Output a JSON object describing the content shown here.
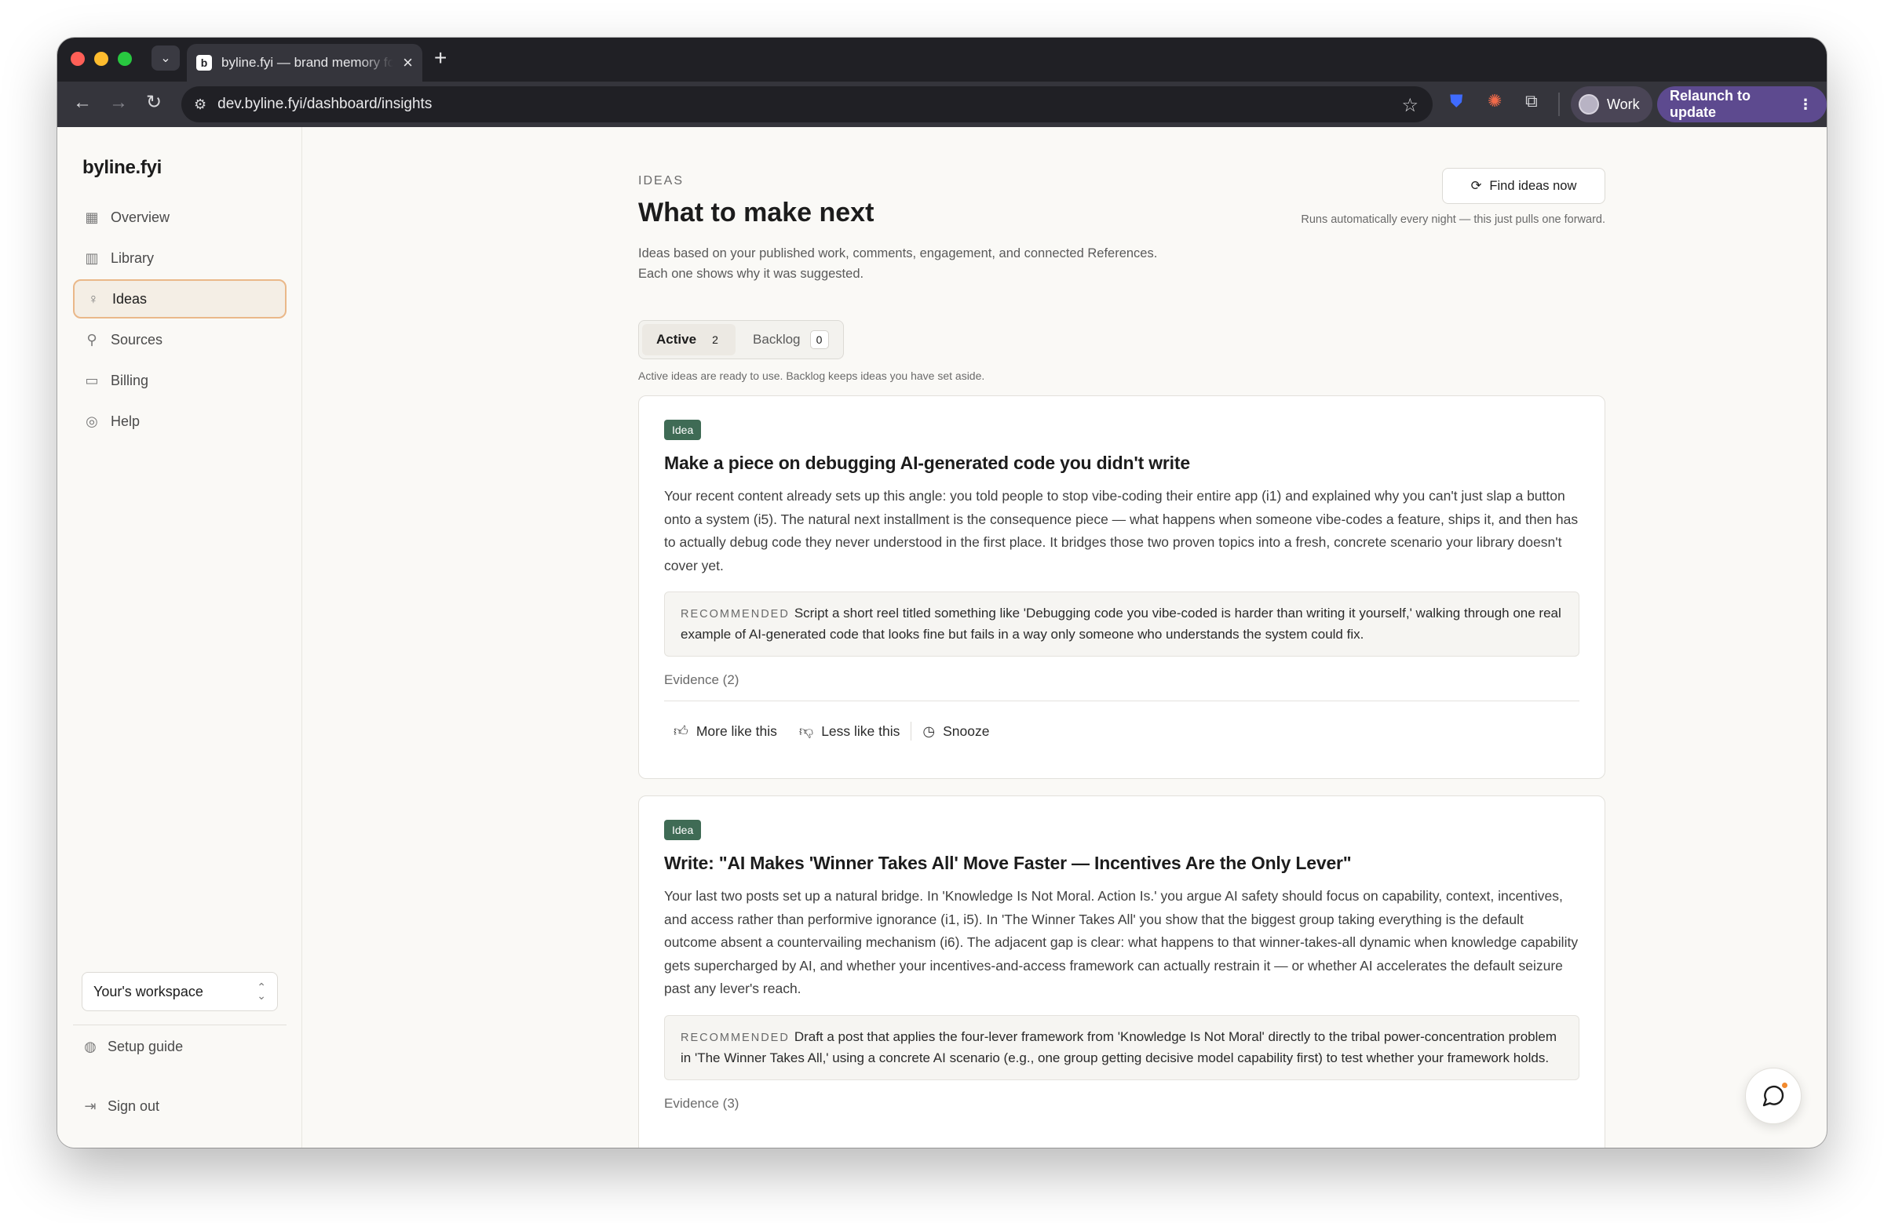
{
  "browser": {
    "tab_title": "byline.fyi — brand memory for",
    "favicon_letter": "b",
    "url": "dev.byline.fyi/dashboard/insights",
    "profile_label": "Work",
    "relaunch_label": "Relaunch to update"
  },
  "sidebar": {
    "brand": "byline.fyi",
    "items": [
      {
        "label": "Overview",
        "icon": "grid-icon"
      },
      {
        "label": "Library",
        "icon": "books-icon"
      },
      {
        "label": "Ideas",
        "icon": "lightbulb-icon",
        "active": true
      },
      {
        "label": "Sources",
        "icon": "plug-icon"
      },
      {
        "label": "Billing",
        "icon": "credit-card-icon"
      },
      {
        "label": "Help",
        "icon": "lifebuoy-icon"
      }
    ],
    "workspace_label": "Your's workspace",
    "setup_guide": "Setup guide",
    "sign_out": "Sign out"
  },
  "header": {
    "eyebrow": "IDEAS",
    "title": "What to make next",
    "description_line1": "Ideas based on your published work, comments, engagement, and connected References.",
    "description_line2": "Each one shows why it was suggested.",
    "find_button": "Find ideas now",
    "find_note": "Runs automatically every night — this just pulls one forward."
  },
  "tabs": {
    "active_label": "Active",
    "active_count": "2",
    "backlog_label": "Backlog",
    "backlog_count": "0",
    "note": "Active ideas are ready to use. Backlog keeps ideas you have set aside."
  },
  "ideas": [
    {
      "badge": "Idea",
      "title": "Make a piece on debugging AI-generated code you didn't write",
      "body": "Your recent content already sets up this angle: you told people to stop vibe-coding their entire app (i1) and explained why you can't just slap a button onto a system (i5). The natural next installment is the consequence piece — what happens when someone vibe-codes a feature, ships it, and then has to actually debug code they never understood in the first place. It bridges those two proven topics into a fresh, concrete scenario your library doesn't cover yet.",
      "recommended_label": "RECOMMENDED",
      "recommended": "Script a short reel titled something like 'Debugging code you vibe-coded is harder than writing it yourself,' walking through one real example of AI-generated code that looks fine but fails in a way only someone who understands the system could fix.",
      "evidence": "Evidence (2)",
      "actions": {
        "more": "More like this",
        "less": "Less like this",
        "snooze": "Snooze"
      }
    },
    {
      "badge": "Idea",
      "title": "Write: \"AI Makes 'Winner Takes All' Move Faster — Incentives Are the Only Lever\"",
      "body": "Your last two posts set up a natural bridge. In 'Knowledge Is Not Moral. Action Is.' you argue AI safety should focus on capability, context, incentives, and access rather than performive ignorance (i1, i5). In 'The Winner Takes All' you show that the biggest group taking everything is the default outcome absent a countervailing mechanism (i6). The adjacent gap is clear: what happens to that winner-takes-all dynamic when knowledge capability gets supercharged by AI, and whether your incentives-and-access framework can actually restrain it — or whether AI accelerates the default seizure past any lever's reach.",
      "recommended_label": "RECOMMENDED",
      "recommended": "Draft a post that applies the four-lever framework from 'Knowledge Is Not Moral' directly to the tribal power-concentration problem in 'The Winner Takes All,' using a concrete AI scenario (e.g., one group getting decisive model capability first) to test whether your framework holds.",
      "evidence": "Evidence (3)"
    }
  ],
  "colors": {
    "accent_border": "#eab889",
    "badge": "#3f6b55",
    "notification_dot": "#f28a2e"
  }
}
